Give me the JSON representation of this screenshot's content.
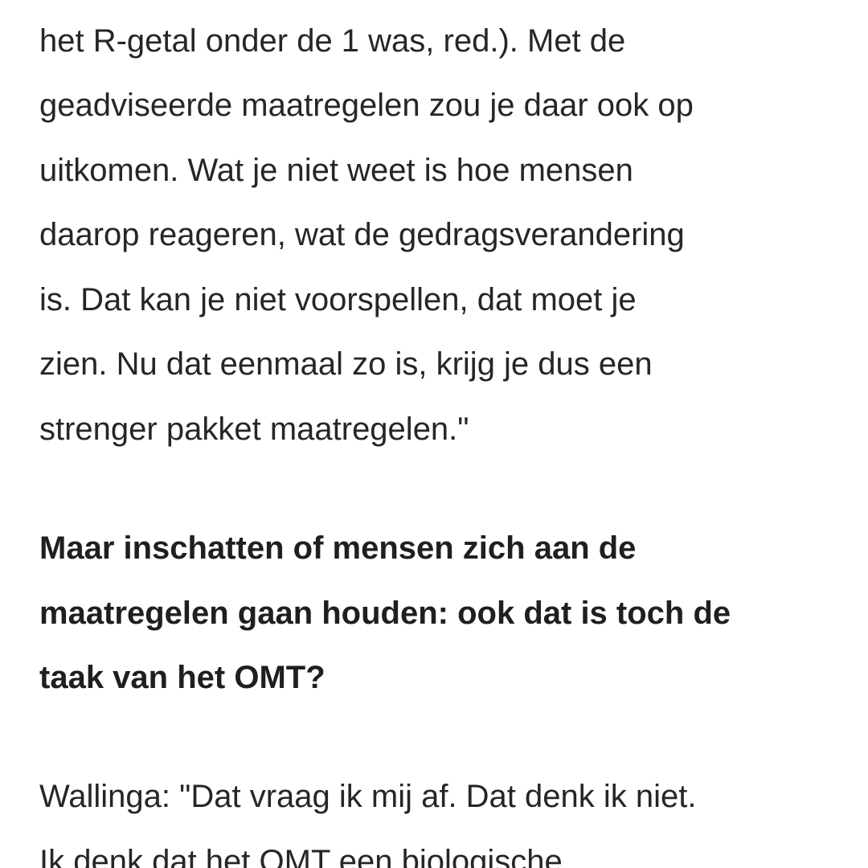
{
  "article": {
    "paragraph_1": [
      "het R-getal onder de 1 was, red.). Met de",
      "geadviseerde maatregelen zou je daar ook op",
      "uitkomen. Wat je niet weet is hoe mensen",
      "daarop reageren, wat de gedragsverandering",
      "is. Dat kan je niet voorspellen, dat moet je",
      "zien. Nu dat eenmaal zo is, krijg je dus een",
      "strenger pakket maatregelen.\""
    ],
    "question": [
      "Maar inschatten of mensen zich aan de",
      "maatregelen gaan houden: ook dat is toch de",
      "taak van het OMT?"
    ],
    "paragraph_2": [
      "Wallinga: \"Dat vraag ik mij af. Dat denk ik niet.",
      "Ik denk dat het OMT een biologische"
    ]
  }
}
